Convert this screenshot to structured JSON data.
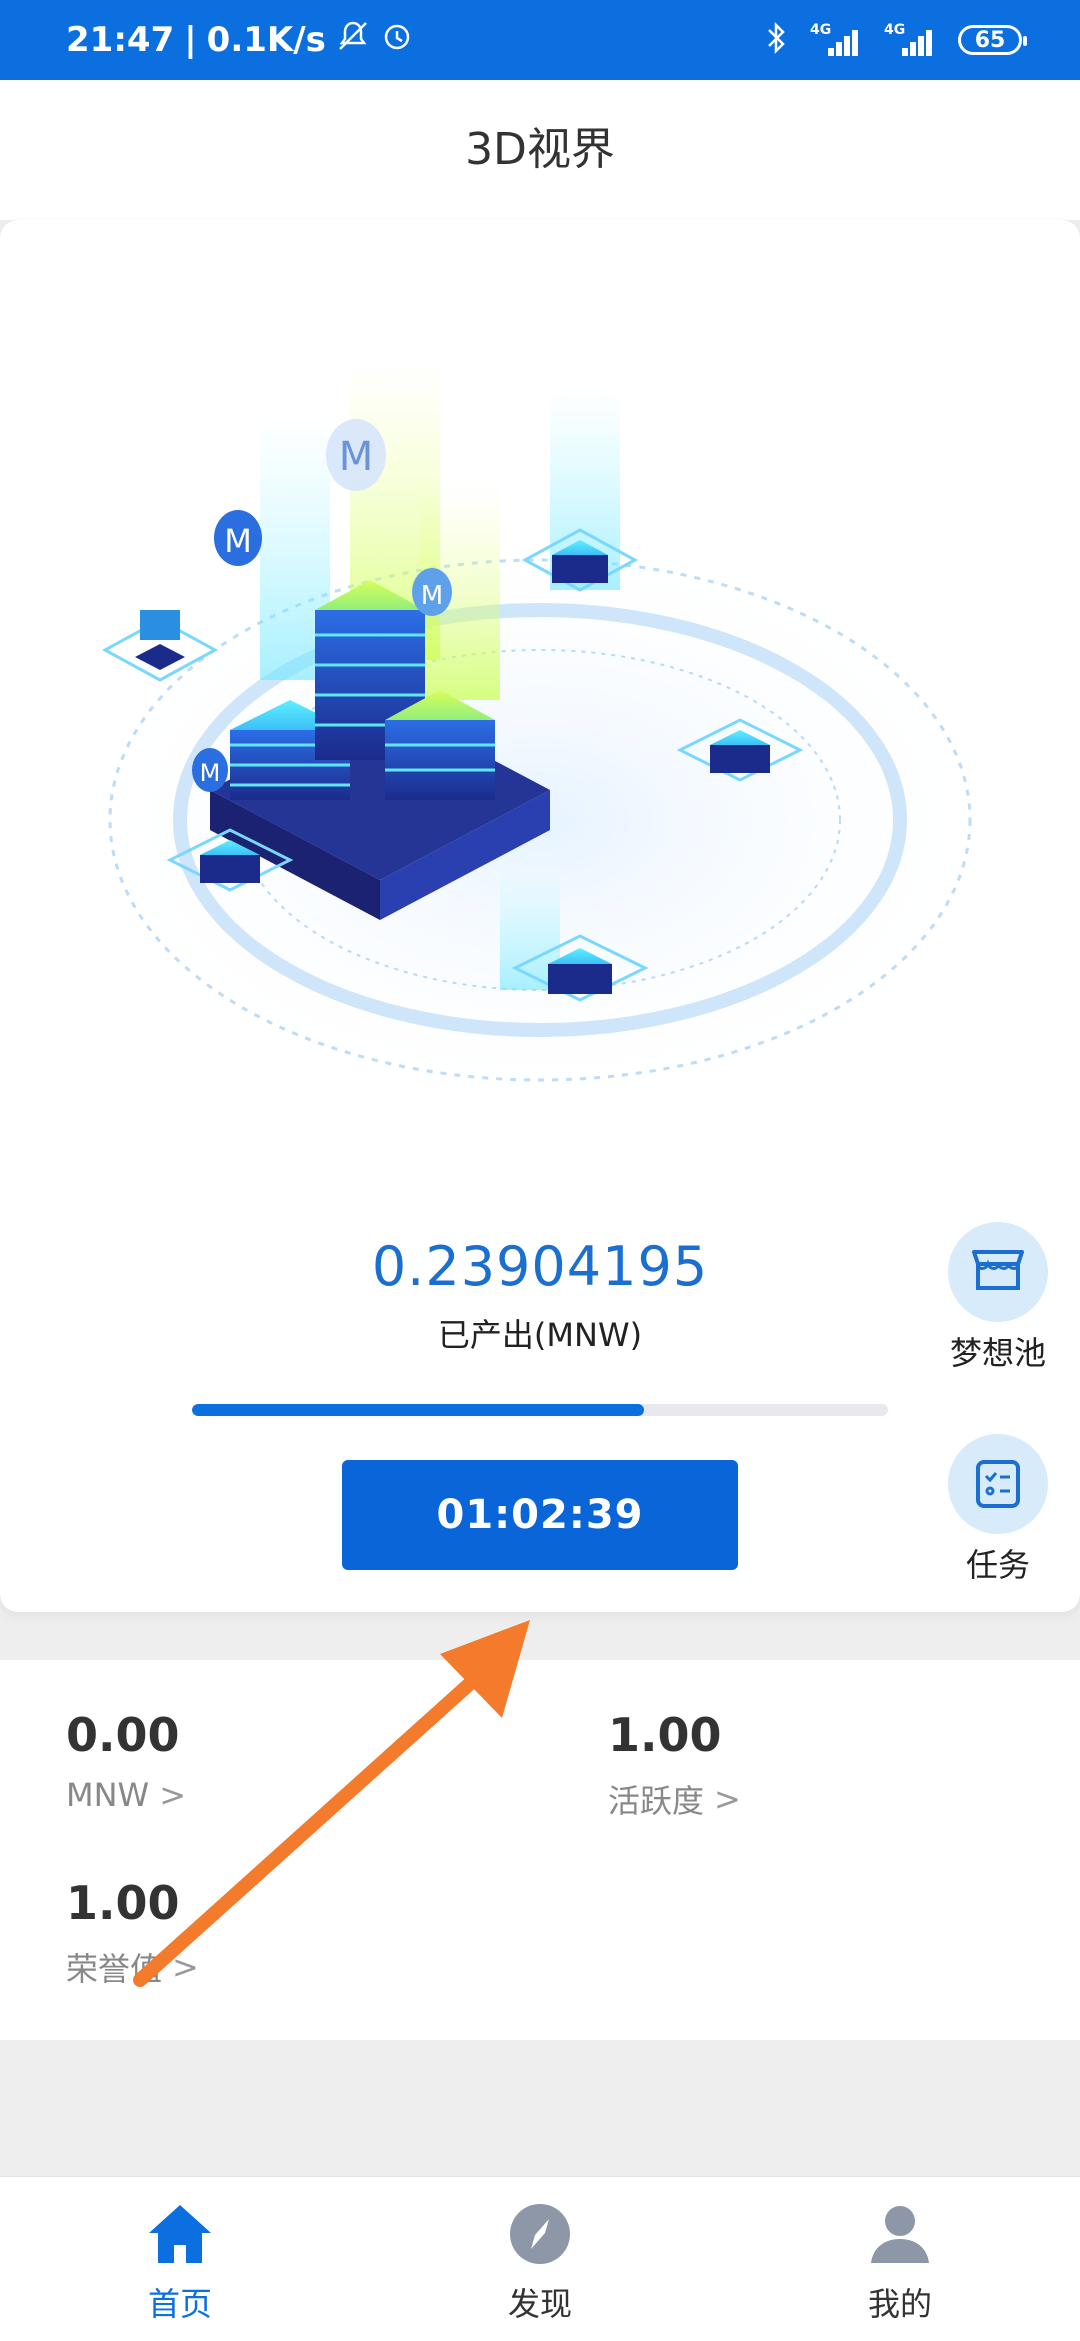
{
  "status_bar": {
    "time": "21:47",
    "net_speed": "0.1K/s",
    "signal_1": "4G",
    "signal_2": "4G",
    "battery": "65"
  },
  "header": {
    "title": "3D视界"
  },
  "mining": {
    "amount": "0.23904195",
    "amount_label": "已产出(MNW)",
    "progress": 0.65,
    "timer": "01:02:39"
  },
  "side_actions": [
    {
      "label": "梦想池",
      "icon": "store-icon"
    },
    {
      "label": "任务",
      "icon": "task-list-icon"
    }
  ],
  "stats": [
    {
      "value": "0.00",
      "label": "MNW"
    },
    {
      "value": "1.00",
      "label": "活跃度"
    },
    {
      "value": "1.00",
      "label": "荣誉值"
    }
  ],
  "nav": [
    {
      "label": "首页",
      "icon": "home-icon",
      "active": true
    },
    {
      "label": "发现",
      "icon": "compass-icon",
      "active": false
    },
    {
      "label": "我的",
      "icon": "profile-icon",
      "active": false
    }
  ],
  "colors": {
    "primary": "#0b6fe0",
    "amount": "#1a6fd0",
    "arrow": "#f47a2c"
  }
}
